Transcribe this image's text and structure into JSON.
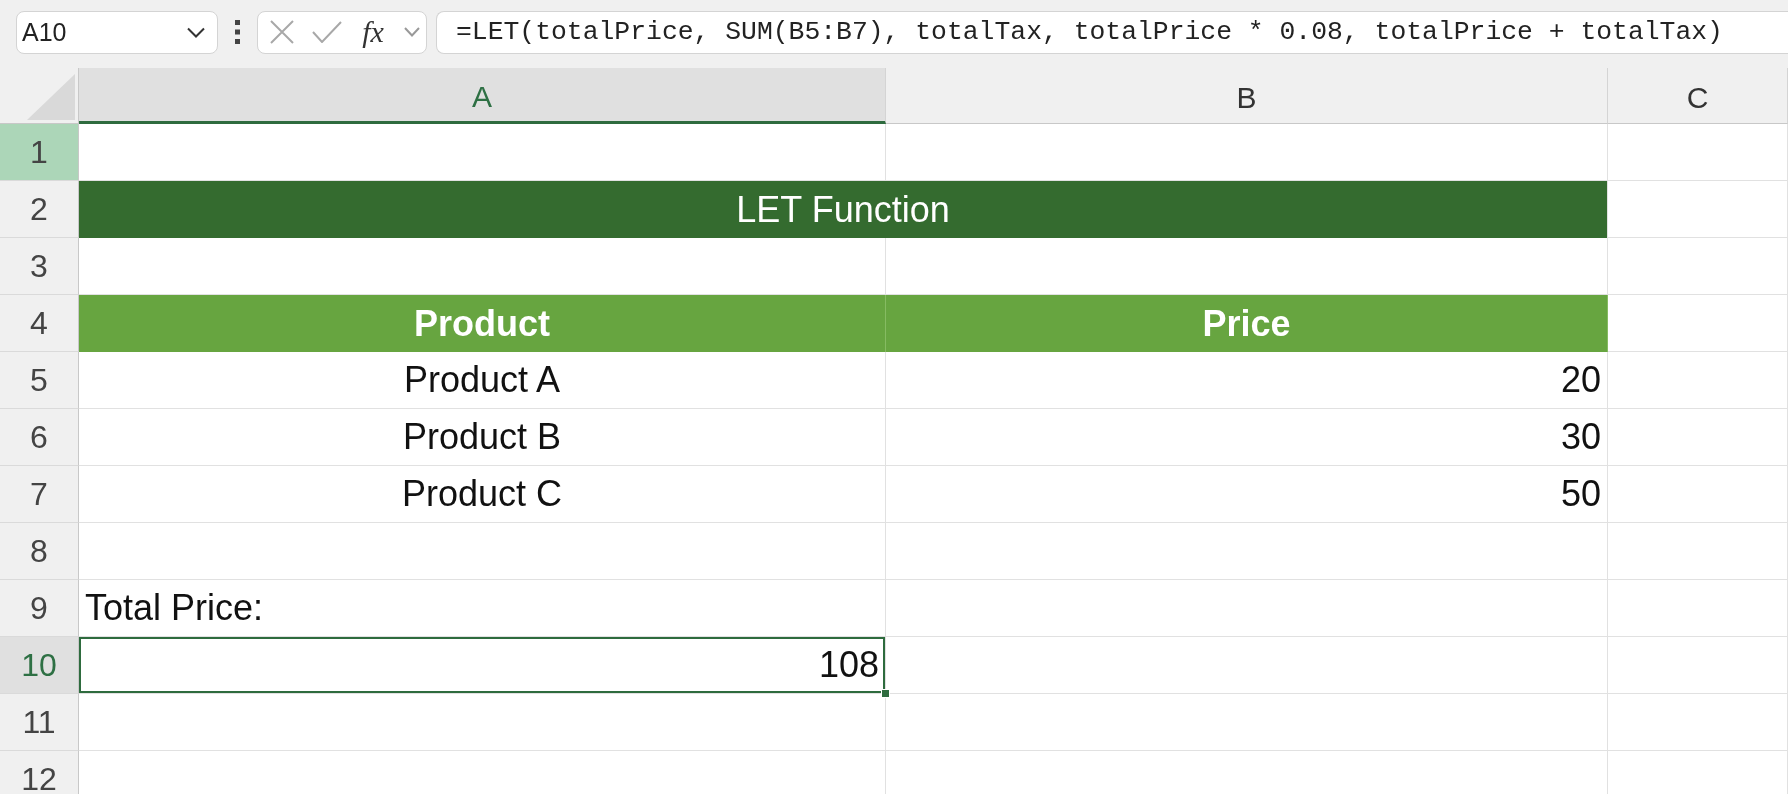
{
  "formula_bar": {
    "name_box": "A10",
    "function_button": "fx",
    "formula": "=LET(totalPrice, SUM(B5:B7), totalTax, totalPrice * 0.08, totalPrice + totalTax)"
  },
  "column_headers": [
    {
      "label": "A",
      "selected": true
    },
    {
      "label": "B",
      "selected": false
    },
    {
      "label": "C",
      "selected": false
    }
  ],
  "rows": [
    {
      "header": "1",
      "selected": false,
      "highlighted": true
    },
    {
      "header": "2",
      "selected": false,
      "highlighted": false,
      "a": {
        "text": "LET Function",
        "kind": "title",
        "selected": false
      }
    },
    {
      "header": "3",
      "selected": false,
      "highlighted": false
    },
    {
      "header": "4",
      "selected": false,
      "highlighted": false,
      "a": {
        "text": "Product",
        "kind": "heading",
        "selected": false
      },
      "b": {
        "text": "Price",
        "kind": "heading",
        "selected": false
      }
    },
    {
      "header": "5",
      "selected": false,
      "highlighted": false,
      "a": {
        "text": "Product A",
        "kind": "item",
        "selected": false
      },
      "b": {
        "text": "20",
        "kind": "number",
        "selected": false
      }
    },
    {
      "header": "6",
      "selected": false,
      "highlighted": false,
      "a": {
        "text": "Product B",
        "kind": "item",
        "selected": false
      },
      "b": {
        "text": "30",
        "kind": "number",
        "selected": false
      }
    },
    {
      "header": "7",
      "selected": false,
      "highlighted": false,
      "a": {
        "text": "Product C",
        "kind": "item",
        "selected": false
      },
      "b": {
        "text": "50",
        "kind": "number",
        "selected": false
      }
    },
    {
      "header": "8",
      "selected": false,
      "highlighted": false
    },
    {
      "header": "9",
      "selected": false,
      "highlighted": false,
      "a": {
        "text": "Total Price:",
        "kind": "label",
        "selected": false
      }
    },
    {
      "header": "10",
      "selected": true,
      "highlighted": false,
      "a": {
        "text": "108",
        "kind": "number",
        "selected": true
      }
    },
    {
      "header": "11",
      "selected": false,
      "highlighted": false
    },
    {
      "header": "12",
      "selected": false,
      "highlighted": false
    }
  ]
}
